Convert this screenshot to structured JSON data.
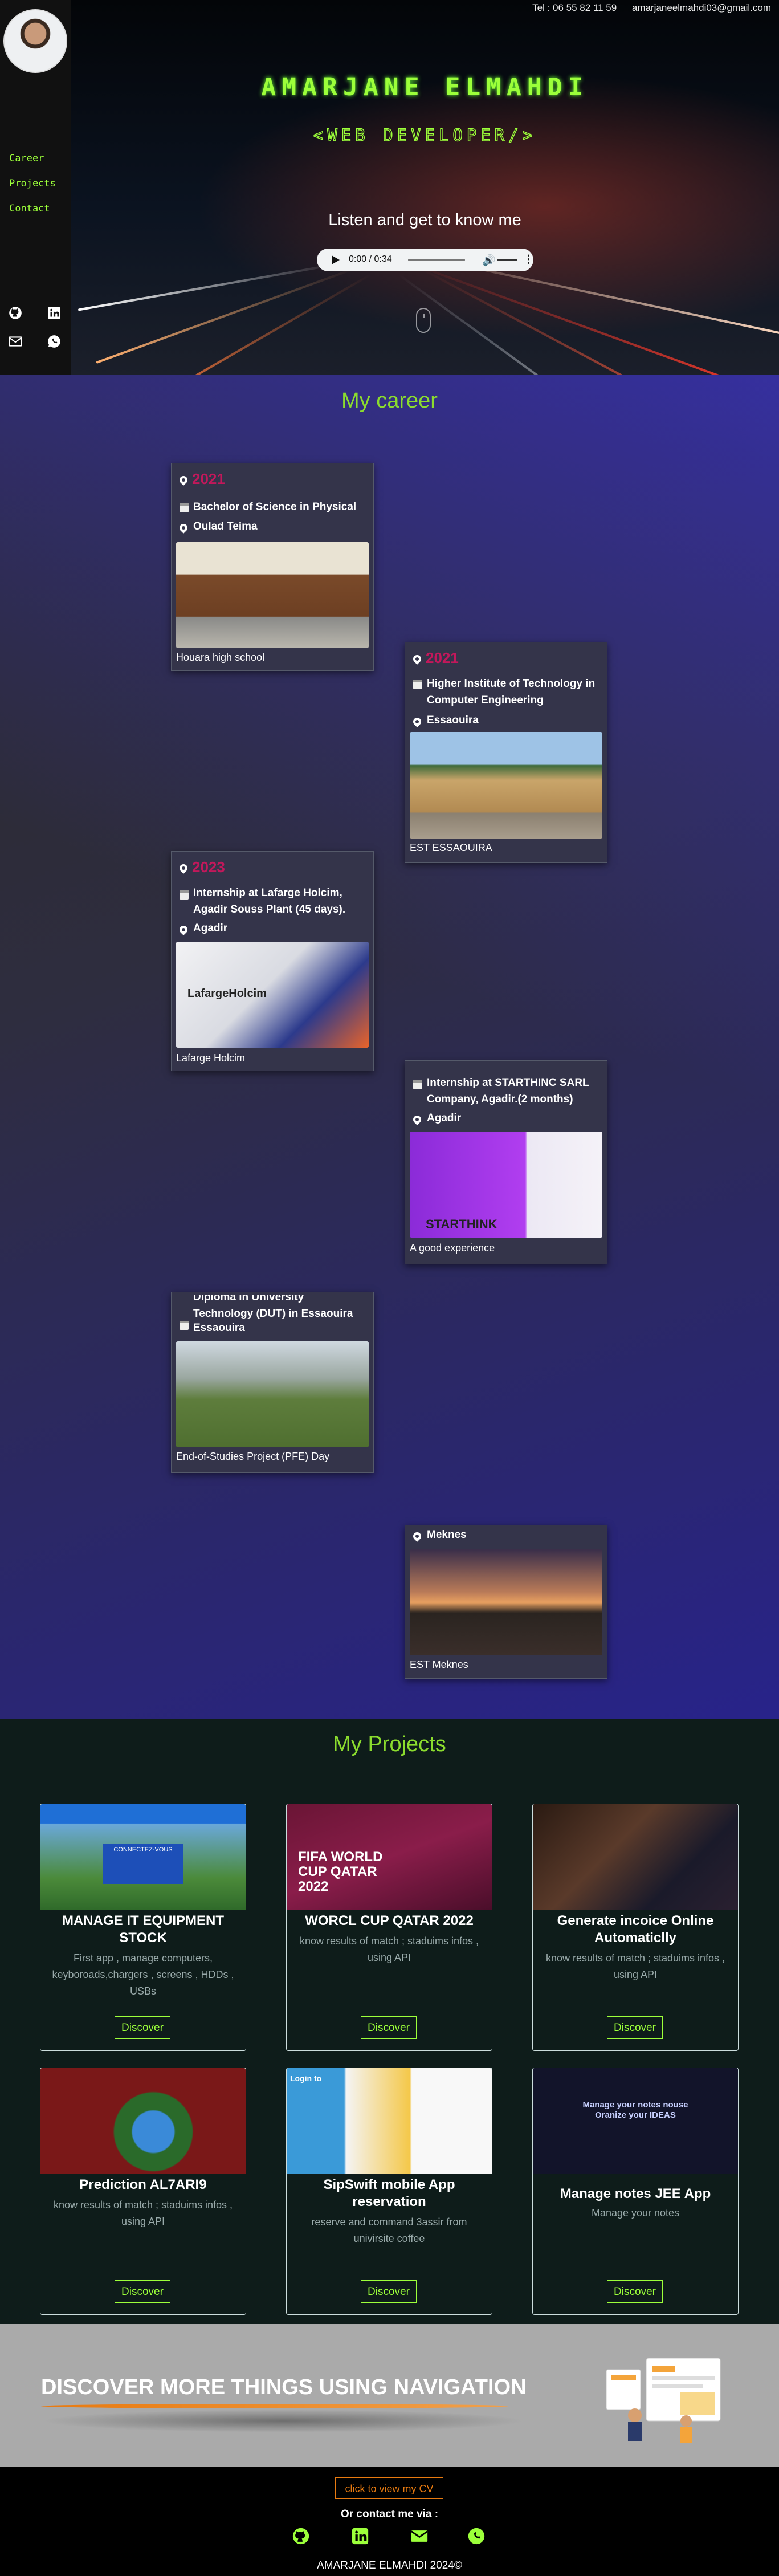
{
  "topbar": {
    "phone": "Tel : 06 55 82 11 59",
    "email": "amarjaneelmahdi03@gmail.com"
  },
  "sidebar": {
    "nav": [
      "Career",
      "Projects",
      "Contact"
    ],
    "icons": [
      "github-icon",
      "linkedin-icon",
      "mail-icon",
      "whatsapp-icon"
    ]
  },
  "hero": {
    "name": "AMARJANE ELMAHDI",
    "role": "<WEB DEVELOPER/>",
    "listen": "Listen and get to know me",
    "audio_time": "0:00 / 0:34"
  },
  "career": {
    "title": "My career",
    "items": [
      {
        "year": "2021",
        "title": "Bachelor of Science in Physical",
        "place": "Oulad Teima",
        "caption": "Houara high school"
      },
      {
        "year": "2021",
        "title": "Higher Institute of Technology in Computer Engineering",
        "place": "Essaouira",
        "caption": "EST ESSAOUIRA"
      },
      {
        "year": "2023",
        "title": "Internship at Lafarge Holcim, Agadir Souss Plant (45 days).",
        "place": "Agadir",
        "caption": "Lafarge Holcim",
        "photo_text": "LafargeHolcim"
      },
      {
        "year": "",
        "title": "Internship at STARTHINC SARL Company, Agadir.(2 months)",
        "place": "Agadir",
        "caption": "A good experience",
        "photo_text": "STARTHINK"
      },
      {
        "year": "",
        "title": "Diploma in University Technology (DUT) in Essaouira",
        "place": "Essaouira",
        "caption": "End-of-Studies Project (PFE) Day"
      },
      {
        "year": "",
        "title": "",
        "place": "Meknes",
        "caption": "EST Meknes"
      }
    ]
  },
  "projects": {
    "title": "My Projects",
    "button": "Discover",
    "items": [
      {
        "title": "MANAGE IT EQUIPMENT STOCK",
        "desc": "First app , manage computers, keyboroads,chargers , screens , HDDs , USBs",
        "shot_text": "CONNECTEZ-VOUS"
      },
      {
        "title": "WORCL CUP QATAR 2022",
        "desc": "know results of match ; staduims infos , using API",
        "shot_text": "FIFA WORLD CUP QATAR 2022"
      },
      {
        "title": "Generate incoice Online Automaticlly",
        "desc": "know results of match ; staduims infos , using API",
        "shot_text": ""
      },
      {
        "title": "Prediction AL7ARI9",
        "desc": "know results of match ; staduims infos , using API",
        "shot_text": ""
      },
      {
        "title": "SipSwift mobile App reservation",
        "desc": "reserve and command 3assir from univirsite coffee",
        "shot_text": "Login to"
      },
      {
        "title": "Manage notes JEE App",
        "desc": "Manage your notes",
        "shot_text": "Manage your notes nouse Oranize your IDEAS"
      }
    ]
  },
  "discover": {
    "text": "DISCOVER MORE THINGS USING NAVIGATION"
  },
  "footer": {
    "cv": "click to view my CV",
    "contact_via": "Or contact me via :",
    "icons": [
      "github-icon",
      "linkedin-icon",
      "mail-icon",
      "whatsapp-icon"
    ],
    "copyright": "AMARJANE ELMAHDI 2024©"
  },
  "colors": {
    "accent": "#9cff3a",
    "year": "#c2185b",
    "cv": "#e87a10",
    "projects_bg": "#0e1c1a"
  }
}
